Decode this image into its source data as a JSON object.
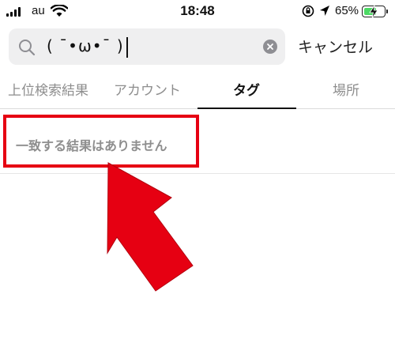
{
  "status_bar": {
    "carrier": "au",
    "time": "18:48",
    "battery_percent": "65%",
    "battery_level": 0.65,
    "battery_color": "#4cd964"
  },
  "search": {
    "query": "( ˉ•ω•ˉ )",
    "cancel_label": "キャンセル",
    "icon": "search-icon",
    "clear_icon": "clear-icon"
  },
  "tabs": [
    {
      "label": "上位検索結果",
      "active": false
    },
    {
      "label": "アカウント",
      "active": false
    },
    {
      "label": "タグ",
      "active": true
    },
    {
      "label": "場所",
      "active": false
    }
  ],
  "result": {
    "empty_message": "一致する結果はありません"
  },
  "annotation": {
    "highlight_color": "#e60012",
    "arrow_color": "#e60012"
  }
}
